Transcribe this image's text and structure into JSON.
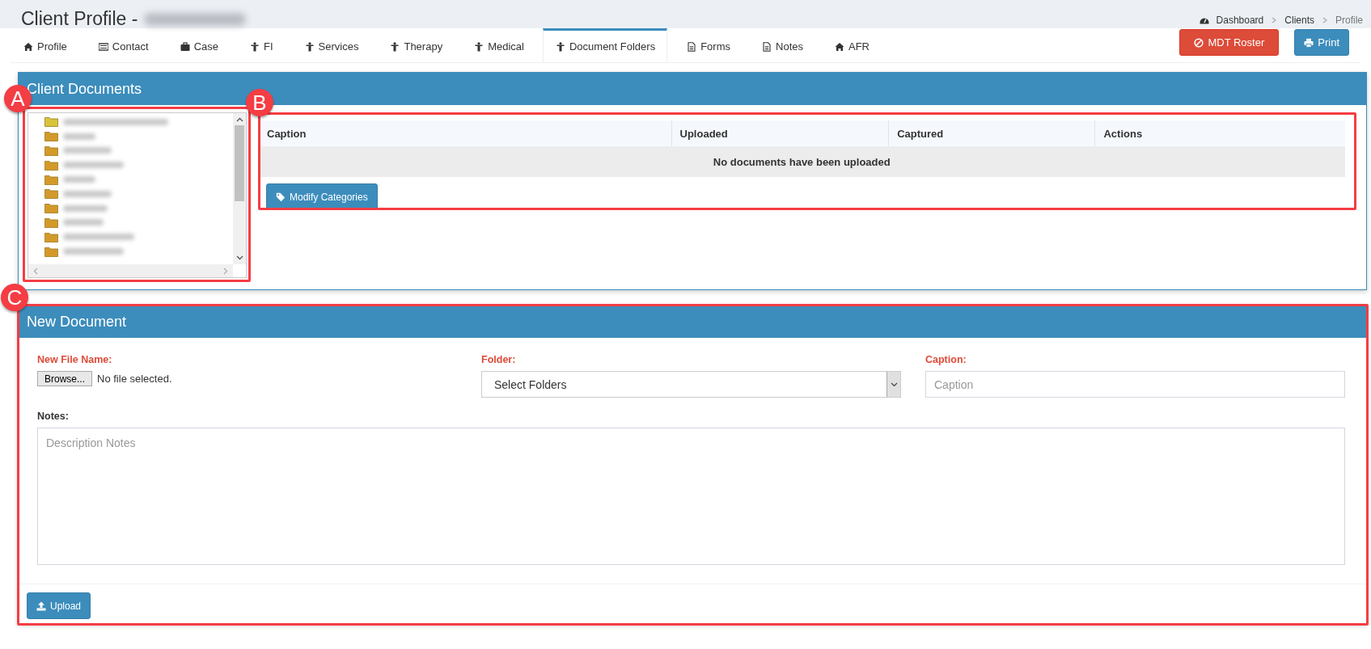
{
  "page_title": "Client Profile -",
  "breadcrumbs": [
    {
      "label": "Dashboard",
      "kind": "dashboard"
    },
    {
      "label": "Clients",
      "kind": "link"
    },
    {
      "label": "Profile",
      "kind": "current"
    }
  ],
  "tabs": [
    {
      "label": "Profile",
      "kind": "home",
      "selected": false
    },
    {
      "label": "Contact",
      "kind": "list",
      "selected": false
    },
    {
      "label": "Case",
      "kind": "briefcase",
      "selected": false
    },
    {
      "label": "FI",
      "kind": "person",
      "selected": false
    },
    {
      "label": "Services",
      "kind": "person",
      "selected": false
    },
    {
      "label": "Therapy",
      "kind": "person",
      "selected": false
    },
    {
      "label": "Medical",
      "kind": "person",
      "selected": false
    },
    {
      "label": "Document Folders",
      "kind": "person",
      "selected": true
    },
    {
      "label": "Forms",
      "kind": "file",
      "selected": false
    },
    {
      "label": "Notes",
      "kind": "file",
      "selected": false
    },
    {
      "label": "AFR",
      "kind": "home",
      "selected": false
    }
  ],
  "actions": [
    {
      "label": "MDT Roster",
      "kind": "danger"
    },
    {
      "label": "Print",
      "kind": "primary"
    }
  ],
  "client_documents": {
    "title": "Client Documents",
    "folders": [
      {
        "selected": true
      },
      {
        "selected": false
      },
      {
        "selected": false
      },
      {
        "selected": false
      },
      {
        "selected": false
      },
      {
        "selected": false
      },
      {
        "selected": false
      },
      {
        "selected": false
      },
      {
        "selected": false
      },
      {
        "selected": false
      }
    ],
    "table": {
      "columns": [
        "Caption",
        "Uploaded",
        "Captured",
        "Actions"
      ],
      "empty_message": "No documents have been uploaded"
    },
    "button": "Modify Categories"
  },
  "new_document": {
    "title": "New Document",
    "file_label": "New File Name:",
    "browse_button": "Browse...",
    "file_status": "No file selected.",
    "folder_label": "Folder:",
    "folder_value": "Select Folders",
    "caption_label": "Caption:",
    "caption_placeholder": "Caption",
    "notes_label": "Notes:",
    "notes_placeholder": "Description Notes",
    "upload_button": "Upload"
  },
  "annotations": [
    {
      "label": "A"
    },
    {
      "label": "B"
    },
    {
      "label": "C"
    }
  ]
}
